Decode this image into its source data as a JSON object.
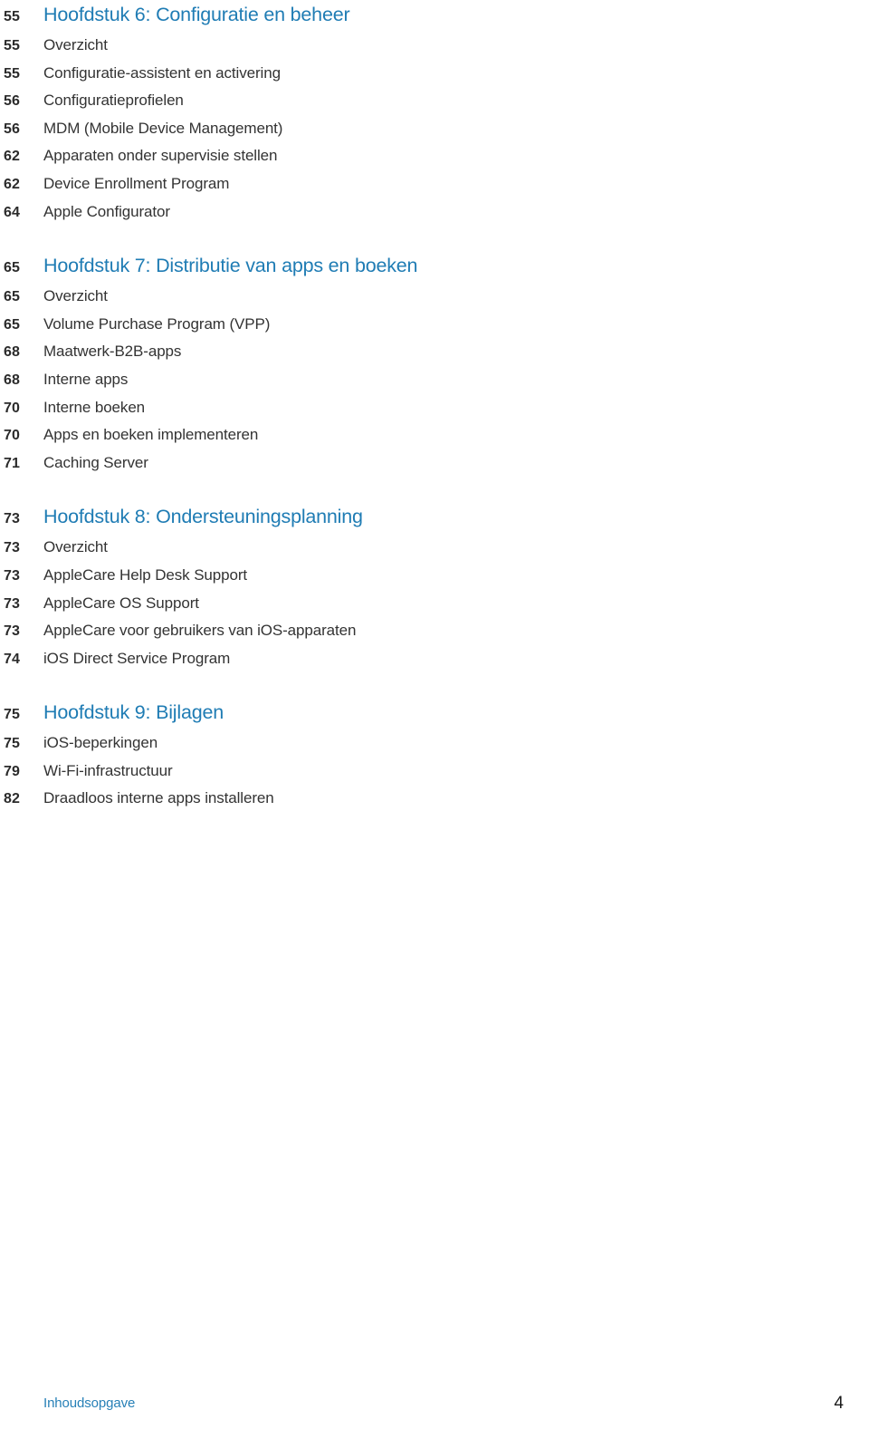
{
  "document": {
    "type": "table-of-contents",
    "language": "nl"
  },
  "sections": [
    {
      "chapter": {
        "page": "55",
        "title": "Hoofdstuk 6: Configuratie en beheer"
      },
      "entries": [
        {
          "page": "55",
          "title": "Overzicht"
        },
        {
          "page": "55",
          "title": "Configuratie-assistent en activering"
        },
        {
          "page": "56",
          "title": "Configuratieprofielen"
        },
        {
          "page": "56",
          "title": "MDM (Mobile Device Management)"
        },
        {
          "page": "62",
          "title": "Apparaten onder supervisie stellen"
        },
        {
          "page": "62",
          "title": "Device Enrollment Program"
        },
        {
          "page": "64",
          "title": "Apple Configurator"
        }
      ]
    },
    {
      "chapter": {
        "page": "65",
        "title": "Hoofdstuk 7: Distributie van apps en boeken"
      },
      "entries": [
        {
          "page": "65",
          "title": "Overzicht"
        },
        {
          "page": "65",
          "title": "Volume Purchase Program (VPP)"
        },
        {
          "page": "68",
          "title": "Maatwerk-B2B-apps"
        },
        {
          "page": "68",
          "title": "Interne apps"
        },
        {
          "page": "70",
          "title": "Interne boeken"
        },
        {
          "page": "70",
          "title": "Apps en boeken implementeren"
        },
        {
          "page": "71",
          "title": "Caching Server"
        }
      ]
    },
    {
      "chapter": {
        "page": "73",
        "title": "Hoofdstuk 8: Ondersteuningsplanning"
      },
      "entries": [
        {
          "page": "73",
          "title": "Overzicht"
        },
        {
          "page": "73",
          "title": "AppleCare Help Desk Support"
        },
        {
          "page": "73",
          "title": "AppleCare OS Support"
        },
        {
          "page": "73",
          "title": "AppleCare voor gebruikers van iOS-apparaten"
        },
        {
          "page": "74",
          "title": "iOS Direct Service Program"
        }
      ]
    },
    {
      "chapter": {
        "page": "75",
        "title": "Hoofdstuk 9: Bijlagen"
      },
      "entries": [
        {
          "page": "75",
          "title": "iOS-beperkingen"
        },
        {
          "page": "79",
          "title": "Wi-Fi-infrastructuur"
        },
        {
          "page": "82",
          "title": "Draadloos interne apps installeren"
        }
      ]
    }
  ],
  "footer": {
    "label": "Inhoudsopgave",
    "page_number": "4"
  },
  "colors": {
    "chapter_heading": "#1f7cb4",
    "body_text": "#333333",
    "page_number": "#2b2b2b",
    "footer_label": "#2780b7",
    "footer_page_number": "#1a1a1a",
    "background": "#ffffff"
  }
}
